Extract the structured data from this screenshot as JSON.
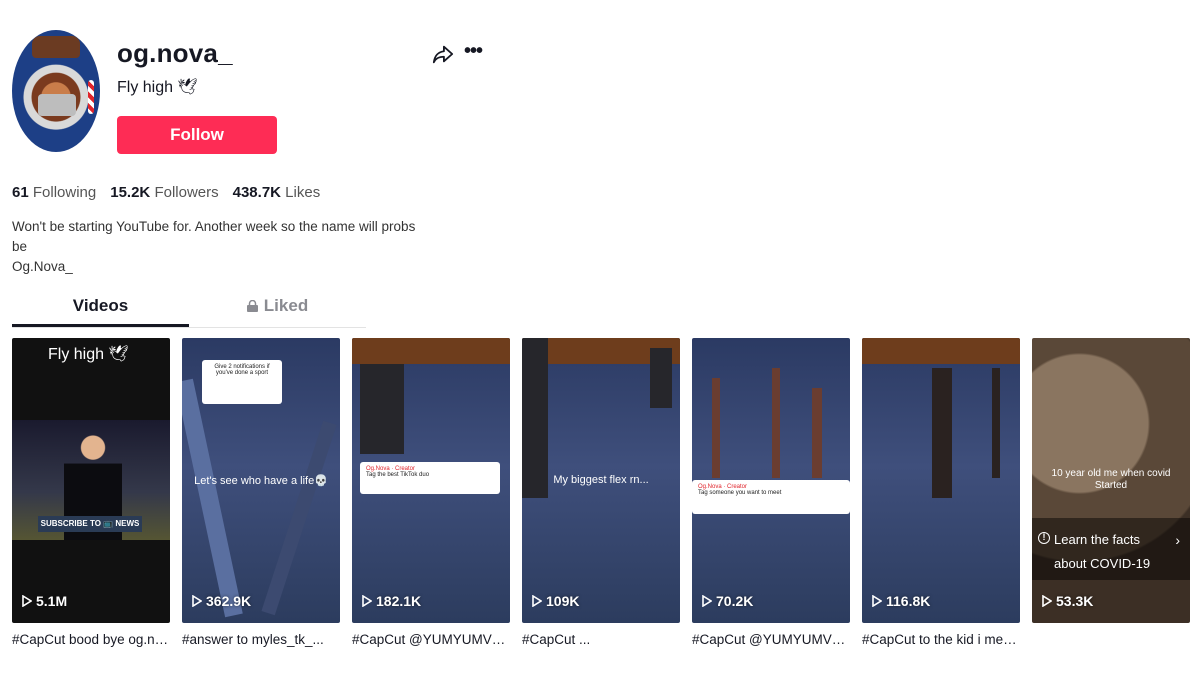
{
  "profile": {
    "username": "og.nova_",
    "nickname": "Fly high 🕊",
    "follow_label": "Follow",
    "stats": [
      {
        "value": "61",
        "label": "Following"
      },
      {
        "value": "15.2K",
        "label": "Followers"
      },
      {
        "value": "438.7K",
        "label": "Likes"
      }
    ],
    "bio_line1": "Won't be starting YouTube for. Another week so the name will probs be",
    "bio_line2": "Og.Nova_"
  },
  "tabs": [
    {
      "label": "Videos",
      "active": true
    },
    {
      "label": "Liked",
      "active": false
    }
  ],
  "videos": [
    {
      "views": "5.1M",
      "caption": "#CapCut bood bye og.no...",
      "overlay": "Fly high 🕊",
      "overlay2": "SUBSCRIBE TO 📺 NEWS"
    },
    {
      "views": "362.9K",
      "caption": "#answer to  myles_tk_...",
      "overlay": "Let's see who have a life💀",
      "overlay2": "Give 2 notifications if you've done a sport"
    },
    {
      "views": "182.1K",
      "caption": "#CapCut @YUMYUMVR ...",
      "overlay": "Tag the best TikTok duo",
      "overlay2": "Og.Nova · Creator"
    },
    {
      "views": "109K",
      "caption": "#CapCut ...",
      "overlay": "My biggest flex rn..."
    },
    {
      "views": "70.2K",
      "caption": "#CapCut @YUMYUMVR c...",
      "overlay": "Tag someone you want to meet",
      "overlay2": "Og.Nova · Creator"
    },
    {
      "views": "116.8K",
      "caption": "#CapCut to the kid i met i..."
    },
    {
      "views": "53.3K",
      "caption": "",
      "overlay": "10 year old me when covid Started",
      "learn": "Learn the facts about COVID-19"
    }
  ],
  "colors": {
    "accent": "#fe2c55",
    "text": "#161823"
  },
  "icons": [
    "share-icon",
    "more-icon",
    "lock-icon",
    "play-icon",
    "info-icon"
  ]
}
